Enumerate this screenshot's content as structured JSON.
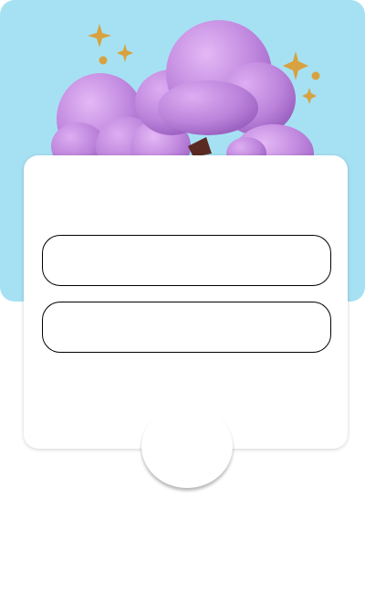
{
  "hero": {
    "icon": "purple-cloud-tree-illustration",
    "background_color": "#A6E1F3",
    "accent_colors": [
      "#C58BE3",
      "#D7A23F"
    ]
  },
  "form": {
    "field_1": {
      "value": "",
      "placeholder": ""
    },
    "field_2": {
      "value": "",
      "placeholder": ""
    },
    "submit_label": ""
  }
}
